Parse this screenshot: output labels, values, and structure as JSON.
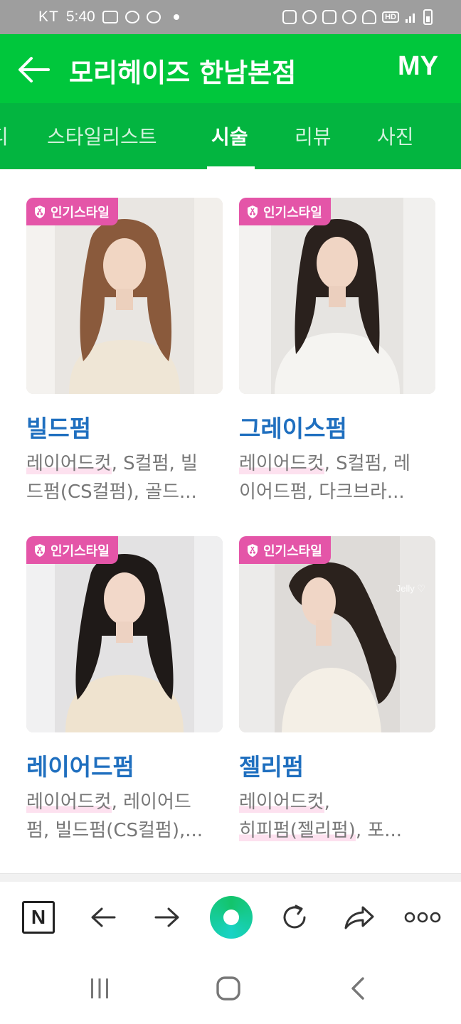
{
  "status_bar": {
    "carrier": "KT",
    "time": "5:40",
    "hd": "HD"
  },
  "header": {
    "title": "모리헤이즈 한남본점",
    "my_label": "MY"
  },
  "tabs": [
    {
      "label": "디"
    },
    {
      "label": "스타일리스트"
    },
    {
      "label": "시술",
      "active": true
    },
    {
      "label": "리뷰"
    },
    {
      "label": "사진"
    }
  ],
  "cards": [
    {
      "badge": "인기스타일",
      "title": "빌드펌",
      "tags_line1_hl": "레이어드컷",
      "tags_line1_rest": ", S컬펌, 빌",
      "tags_line2": "드펌(CS컬펌), 골드..."
    },
    {
      "badge": "인기스타일",
      "title": "그레이스펌",
      "tags_line1_hl": "레이어드컷",
      "tags_line1_rest": ", S컬펌, 레",
      "tags_line2": "이어드펌, 다크브라..."
    },
    {
      "badge": "인기스타일",
      "title": "레이어드펌",
      "tags_line1_hl": "레이어드컷",
      "tags_line1_rest": ", 레이어드",
      "tags_line2": "펌, 빌드펌(CS컬펌),..."
    },
    {
      "badge": "인기스타일",
      "title": "젤리펌",
      "tags_line1_hl": "레이어드컷",
      "tags_line1_rest": ",",
      "tags_line2_hl": "히피펌(젤리펌)",
      "tags_line2_rest": ", 포...",
      "watermark": "Jelly ♡"
    }
  ],
  "icons": {
    "back": "arrow-left-icon",
    "badge": "scissors-shield-icon",
    "toolbar": [
      "naver-n-icon",
      "arrow-left-icon",
      "arrow-right-icon",
      "green-orb-icon",
      "refresh-icon",
      "share-icon",
      "more-dots-icon"
    ],
    "nav": [
      "recent-apps-icon",
      "home-icon",
      "back-chevron-icon"
    ]
  },
  "colors": {
    "header_green": "#00c73c",
    "tab_green": "#03b540",
    "badge_pink": "#e455a8",
    "title_blue": "#1f6fbf",
    "tag_gray": "#777777"
  }
}
